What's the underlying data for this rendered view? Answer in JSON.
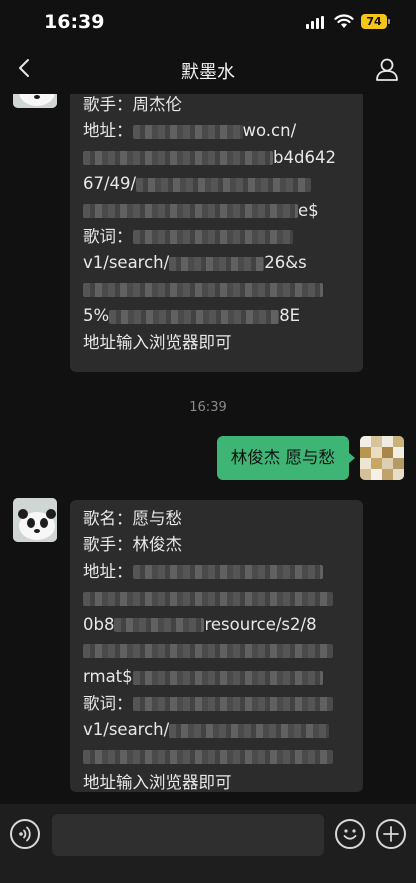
{
  "status_bar": {
    "time": "16:39",
    "battery": "74",
    "icons": [
      "signal-icon",
      "wifi-icon",
      "battery-icon"
    ],
    "battery_color": "#f5c518"
  },
  "nav": {
    "title": "默墨水",
    "left_icon": "back-arrow-icon",
    "right_icon": "person-icon"
  },
  "messages": {
    "first": {
      "lines": [
        "歌手：周杰伦",
        "地址：",
        "wo.cn/",
        "b4d642",
        "67/49/",
        "e$",
        "歌词：",
        "v1/search/",
        "26&s",
        "5%",
        "8E",
        "地址输入浏览器即可"
      ]
    },
    "timestamp": "16:39",
    "sent": {
      "text": "林俊杰 愿与愁"
    },
    "second": {
      "lines": [
        "歌名：愿与愁",
        "歌手：林俊杰",
        "地址：",
        "0b8",
        "resource/s2/8",
        "rmat$",
        "歌词：",
        "v1/search/",
        "地址输入浏览器即可"
      ]
    }
  },
  "input_bar": {
    "placeholder": "",
    "icons": [
      "voice-icon",
      "emoji-icon",
      "plus-icon"
    ]
  },
  "colors": {
    "background": "#111111",
    "bubble_received": "#2c2c2c",
    "bubble_sent": "#3eb575",
    "accent_green": "#3eb575"
  }
}
